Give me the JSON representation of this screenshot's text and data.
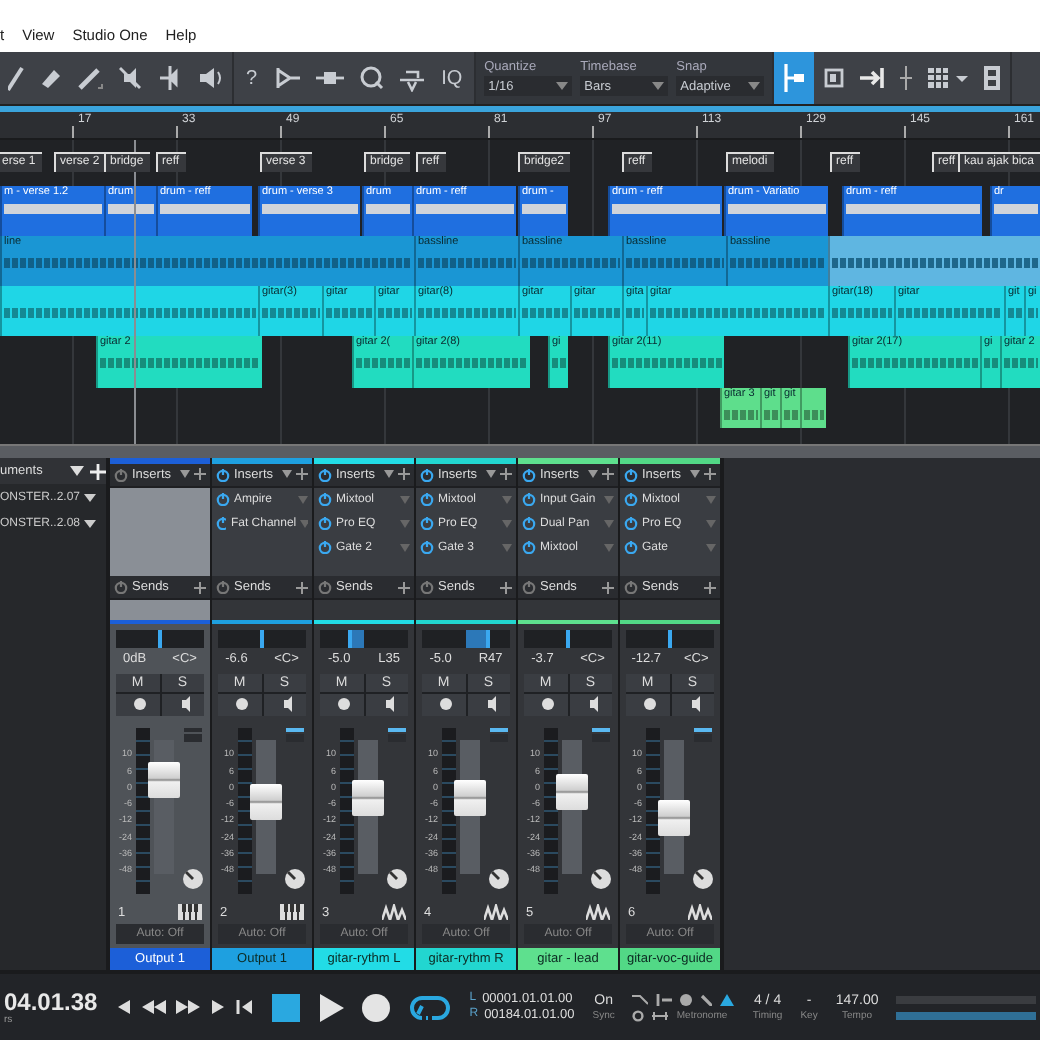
{
  "menu": [
    {
      "label": "t"
    },
    {
      "label": "View"
    },
    {
      "label": "Studio One"
    },
    {
      "label": "Help"
    }
  ],
  "toolbar": {
    "help": "?",
    "iq": "IQ",
    "quantize": {
      "label": "Quantize",
      "value": "1/16"
    },
    "timebase": {
      "label": "Timebase",
      "value": "Bars"
    },
    "snap": {
      "label": "Snap",
      "value": "Adaptive"
    },
    "snap_active": true
  },
  "ruler": [
    "17",
    "33",
    "49",
    "65",
    "81",
    "97",
    "113",
    "129",
    "145",
    "161"
  ],
  "markers": [
    {
      "label": "erse 1"
    },
    {
      "label": "verse 2"
    },
    {
      "label": "bridge"
    },
    {
      "label": "reff"
    },
    {
      "label": "verse 3"
    },
    {
      "label": "bridge"
    },
    {
      "label": "reff"
    },
    {
      "label": "bridge2"
    },
    {
      "label": "reff"
    },
    {
      "label": "melodi"
    },
    {
      "label": "reff"
    },
    {
      "label": "reff"
    },
    {
      "label": "kau ajak bica"
    }
  ],
  "tracks": [
    {
      "kind": "drum",
      "color": "#1f6fe0",
      "clips": [
        {
          "label": "m - verse 1.2",
          "selected": false
        },
        {
          "label": "drum",
          "selected": false
        },
        {
          "label": "drum - reff",
          "selected": false
        },
        {
          "label": "drum - verse 3",
          "selected": false
        },
        {
          "label": "drum",
          "selected": false
        },
        {
          "label": "drum - reff",
          "selected": false
        },
        {
          "label": "drum -",
          "selected": false
        },
        {
          "label": "drum - reff",
          "selected": false
        },
        {
          "label": "drum - Variatio",
          "selected": false
        },
        {
          "label": "drum - reff",
          "selected": false
        },
        {
          "label": "dr",
          "selected": false
        }
      ]
    },
    {
      "kind": "audio",
      "color": "#1a96d4",
      "clips": [
        {
          "label": "line",
          "selected": false
        },
        {
          "label": "bassline",
          "selected": false
        },
        {
          "label": "bassline",
          "selected": false
        },
        {
          "label": "bassline",
          "selected": false
        },
        {
          "label": "bassline",
          "selected": false
        },
        {
          "selected": true
        }
      ]
    },
    {
      "kind": "audio",
      "color": "#1fd6e6",
      "clips": [
        {
          "selected": false
        },
        {
          "label": "gitar(3)",
          "selected": false
        },
        {
          "label": "gitar",
          "selected": false
        },
        {
          "label": "gitar",
          "selected": false
        },
        {
          "label": "gitar(8)",
          "selected": false
        },
        {
          "label": "gitar",
          "selected": false
        },
        {
          "label": "gitar",
          "selected": false
        },
        {
          "label": "gita",
          "selected": false
        },
        {
          "label": "gitar",
          "selected": false
        },
        {
          "label": "gitar(18)",
          "selected": false
        },
        {
          "label": "gitar",
          "selected": false
        },
        {
          "label": "git",
          "selected": false
        },
        {
          "label": "gi",
          "selected": false
        }
      ]
    },
    {
      "kind": "audio",
      "color": "#22dcc0",
      "clips": [
        {
          "label": "gitar 2",
          "selected": false
        },
        {
          "label": "gitar 2(",
          "selected": false
        },
        {
          "label": "gitar 2(8)",
          "selected": false
        },
        {
          "label": "gi",
          "selected": false
        },
        {
          "label": "gitar 2(11)",
          "selected": false
        },
        {
          "label": "gitar 2(17)",
          "selected": false
        },
        {
          "label": "gi",
          "selected": false
        },
        {
          "label": "gitar 2",
          "selected": false
        }
      ]
    },
    {
      "kind": "audio",
      "color": "#5ede8c",
      "clips": [
        {
          "label": "gitar 3",
          "selected": false
        },
        {
          "label": "git",
          "selected": false
        },
        {
          "label": "git",
          "selected": false
        },
        {
          "selected": false
        }
      ]
    }
  ],
  "browser": {
    "title": "uments",
    "items": [
      {
        "label": "ONSTER..2.07"
      },
      {
        "label": "ONSTER..2.08"
      }
    ]
  },
  "channels": [
    {
      "name": "Output 1",
      "color": "#1c5fd8",
      "selected": true,
      "inserts_on": false,
      "inserts_title": "Inserts",
      "sends_title": "Sends",
      "volume": "0dB",
      "pan_text": "<C>",
      "pan": {
        "level": 0.5
      },
      "mute": "M",
      "solo": "S",
      "scale": [
        "10",
        "6",
        "0",
        "-6",
        "-12",
        "-24",
        "-36",
        "-48"
      ],
      "fader": {
        "level": 0.7
      },
      "number": "1",
      "kind": "instrument",
      "auto": "Auto: Off"
    },
    {
      "name": "Output 1",
      "color": "#1ea0e0",
      "selected": false,
      "inserts_on": true,
      "inserts_title": "Inserts",
      "inserts": [
        "Ampire",
        "Fat Channel"
      ],
      "sends_title": "Sends",
      "volume": "-6.6",
      "pan_text": "<C>",
      "pan": {
        "level": 0.5
      },
      "mute": "M",
      "solo": "S",
      "scale": [
        "10",
        "6",
        "0",
        "-6",
        "-12",
        "-24",
        "-36",
        "-48"
      ],
      "fader": {
        "level": 0.55
      },
      "number": "2",
      "kind": "instrument",
      "auto": "Auto: Off"
    },
    {
      "name": "gitar-rythm L",
      "color": "#22dce6",
      "selected": false,
      "inserts_on": true,
      "inserts_title": "Inserts",
      "inserts": [
        "Mixtool",
        "Pro EQ",
        "Gate 2"
      ],
      "sends_title": "Sends",
      "volume": "-5.0",
      "pan_text": "L35",
      "pan": {
        "level": 0.33
      },
      "mute": "M",
      "solo": "S",
      "scale": [
        "10",
        "6",
        "0",
        "-6",
        "-12",
        "-24",
        "-36",
        "-48"
      ],
      "fader": {
        "level": 0.58
      },
      "number": "3",
      "kind": "audio",
      "auto": "Auto: Off"
    },
    {
      "name": "gitar-rythm R",
      "color": "#22d6d0",
      "selected": false,
      "inserts_on": true,
      "inserts_title": "Inserts",
      "inserts": [
        "Mixtool",
        "Pro EQ",
        "Gate 3"
      ],
      "sends_title": "Sends",
      "volume": "-5.0",
      "pan_text": "R47",
      "pan": {
        "level": 0.74
      },
      "mute": "M",
      "solo": "S",
      "scale": [
        "10",
        "6",
        "0",
        "-6",
        "-12",
        "-24",
        "-36",
        "-48"
      ],
      "fader": {
        "level": 0.58
      },
      "number": "4",
      "kind": "audio",
      "auto": "Auto: Off"
    },
    {
      "name": "gitar - lead",
      "color": "#5ee08e",
      "selected": false,
      "inserts_on": true,
      "inserts_title": "Inserts",
      "inserts": [
        "Input Gain",
        "Dual Pan",
        "Mixtool"
      ],
      "sends_title": "Sends",
      "volume": "-3.7",
      "pan_text": "<C>",
      "pan": {
        "level": 0.5
      },
      "mute": "M",
      "solo": "S",
      "scale": [
        "10",
        "6",
        "0",
        "-6",
        "-12",
        "-24",
        "-36",
        "-48"
      ],
      "fader": {
        "level": 0.62
      },
      "number": "5",
      "kind": "audio",
      "auto": "Auto: Off"
    },
    {
      "name": "gitar-voc-guide",
      "color": "#52d886",
      "selected": false,
      "inserts_on": true,
      "inserts_title": "Inserts",
      "inserts": [
        "Mixtool",
        "Pro EQ",
        "Gate"
      ],
      "sends_title": "Sends",
      "volume": "-12.7",
      "pan_text": "<C>",
      "pan": {
        "level": 0.5
      },
      "mute": "M",
      "solo": "S",
      "scale": [
        "10",
        "6",
        "0",
        "-6",
        "-12",
        "-24",
        "-36",
        "-48"
      ],
      "fader": {
        "level": 0.42
      },
      "number": "6",
      "kind": "audio",
      "auto": "Auto: Off"
    }
  ],
  "transport": {
    "time": "04.01.38",
    "time_unit": "rs",
    "stop_active": true,
    "loop_on": true,
    "left": {
      "label": "L",
      "value": "00001.01.01.00"
    },
    "right": {
      "label": "R",
      "value": "00184.01.01.00"
    },
    "sync": {
      "value": "On",
      "label": "Sync"
    },
    "metronome": "Metronome",
    "timing": {
      "value": "4 / 4",
      "label": "Timing"
    },
    "key": {
      "value": "-",
      "label": "Key"
    },
    "tempo": {
      "value": "147.00",
      "label": "Tempo"
    }
  }
}
